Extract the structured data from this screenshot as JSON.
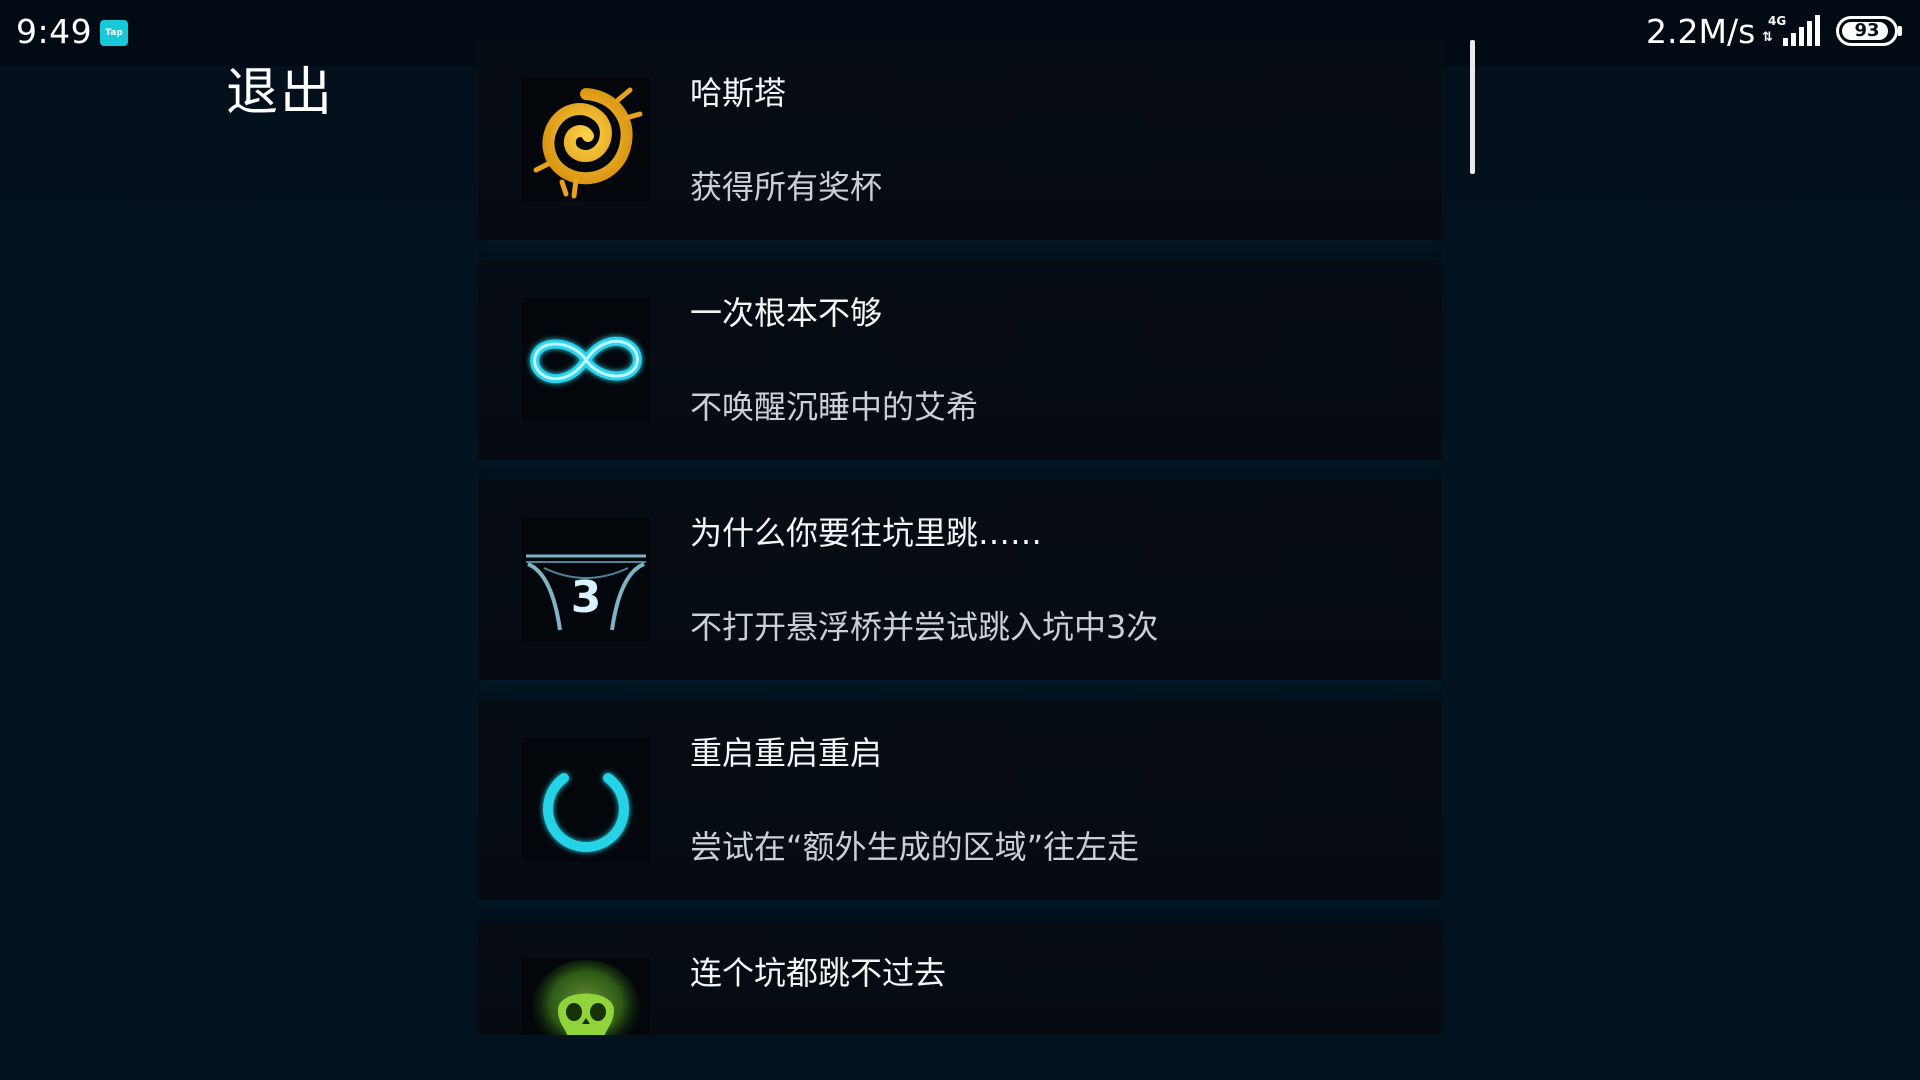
{
  "status_bar": {
    "time": "9:49",
    "app_badge": "Tap",
    "net_speed": "2.2M/s",
    "network_type": "4G",
    "network_arrows": "⇅",
    "battery_level": 93,
    "battery_text": "93"
  },
  "exit_label": "退出",
  "achievements": [
    {
      "title": "哈斯塔",
      "description": "获得所有奖杯",
      "icon": "golden-sigil-icon"
    },
    {
      "title": "一次根本不够",
      "description": "不唤醒沉睡中的艾希",
      "icon": "infinity-icon"
    },
    {
      "title": "为什么你要往坑里跳……",
      "description": "不打开悬浮桥并尝试跳入坑中3次",
      "icon": "pit-three-icon",
      "icon_text": "3"
    },
    {
      "title": "重启重启重启",
      "description": "尝试在“额外生成的区域”往左走",
      "icon": "power-icon"
    },
    {
      "title": "连个坑都跳不过去",
      "description": "",
      "icon": "green-skull-icon"
    }
  ],
  "colors": {
    "background": "#03111d",
    "card": "#070d14",
    "accent_cyan": "#2ad4ec",
    "accent_gold": "#f2b21d",
    "accent_green": "#7bd62f"
  }
}
